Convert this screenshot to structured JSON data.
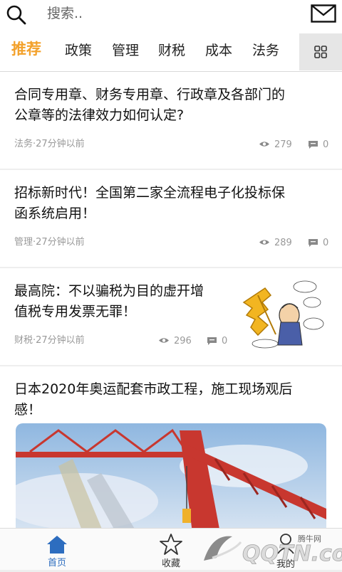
{
  "search": {
    "placeholder": "搜索.."
  },
  "tabs": [
    {
      "label": "推荐"
    },
    {
      "label": "政策"
    },
    {
      "label": "管理"
    },
    {
      "label": "财税"
    },
    {
      "label": "成本"
    },
    {
      "label": "法务"
    }
  ],
  "articles": [
    {
      "title_line1": "合同专用章、财务专用章、行政章及各部门的",
      "title_line2": "公章等的法律效力如何认定?",
      "meta": "法务·27分钟以前",
      "views": "279",
      "comments": "0"
    },
    {
      "title_line1": "招标新时代！全国第二家全流程电子化投标保",
      "title_line2": "函系统启用！",
      "meta": "管理·27分钟以前",
      "views": "289",
      "comments": "0"
    },
    {
      "title_line1": "最高院：不以骗税为目的虚开增",
      "title_line2": "值税专用发票无罪！",
      "meta": "财税·27分钟以前",
      "views": "296",
      "comments": "0"
    },
    {
      "title_line1": "日本2020年奥运配套市政工程，施工现场观后",
      "title_line2": "感！"
    }
  ],
  "bottom_nav": [
    {
      "label": "首页",
      "active": true
    },
    {
      "label": "收藏"
    },
    {
      "label": "我的"
    }
  ],
  "watermark": {
    "text": "QQTN.com",
    "small": "腾牛网"
  },
  "colors": {
    "accent": "#f3a12b",
    "nav_active": "#2d6dbf"
  }
}
